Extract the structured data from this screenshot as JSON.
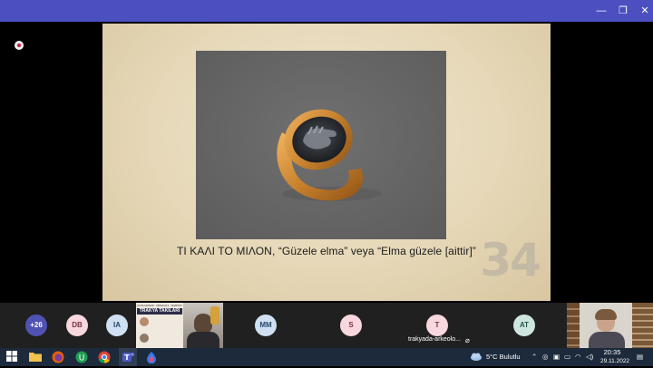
{
  "window": {
    "controls": {
      "minimize": "—",
      "maximize": "❐",
      "close": "✕"
    }
  },
  "slide": {
    "caption": "ΤΙ ΚΑΛΙ ΤΟ ΜΙΛΟΝ, “Güzele elma” veya “Elma güzele [aittir]”",
    "number": "34"
  },
  "participants": [
    {
      "initials": "+26",
      "bg": "#4f52b2",
      "fg": "#ffffff"
    },
    {
      "initials": "DB",
      "bg": "#f8d7de",
      "fg": "#7a3341"
    },
    {
      "initials": "IA",
      "bg": "#cfe0f2",
      "fg": "#25486b"
    },
    {
      "initials": "MM",
      "bg": "#cfe0f2",
      "fg": "#25486b"
    },
    {
      "initials": "S",
      "bg": "#f8d7de",
      "fg": "#7a3341"
    },
    {
      "initials": "T",
      "bg": "#f8d7de",
      "fg": "#7a3341"
    },
    {
      "initials": "AT",
      "bg": "#cfe6e0",
      "fg": "#23584a"
    }
  ],
  "shared_tile": {
    "banner_small": "ULUSLARARASI · ARKEOLOJİ · SEMPOZYUMU",
    "banner_title": "TRAKYA TAKILARI"
  },
  "active_tile_label": "trakyada-arkeolo...",
  "taskbar": {
    "weather": "5°C  Bulutlu",
    "time": "20:35",
    "date": "29.11.2022"
  },
  "colors": {
    "titlebar": "#4b4fbf",
    "strip": "#202020",
    "taskbar": "#1c2a3c",
    "slide_bg": "#e6d8b8",
    "photo_bg": "#676767"
  },
  "icons": [
    "windows-icon",
    "file-explorer-icon",
    "firefox-icon",
    "upwork-icon",
    "chrome-icon",
    "chrome-alt-icon",
    "teams-icon",
    "app-icon"
  ]
}
